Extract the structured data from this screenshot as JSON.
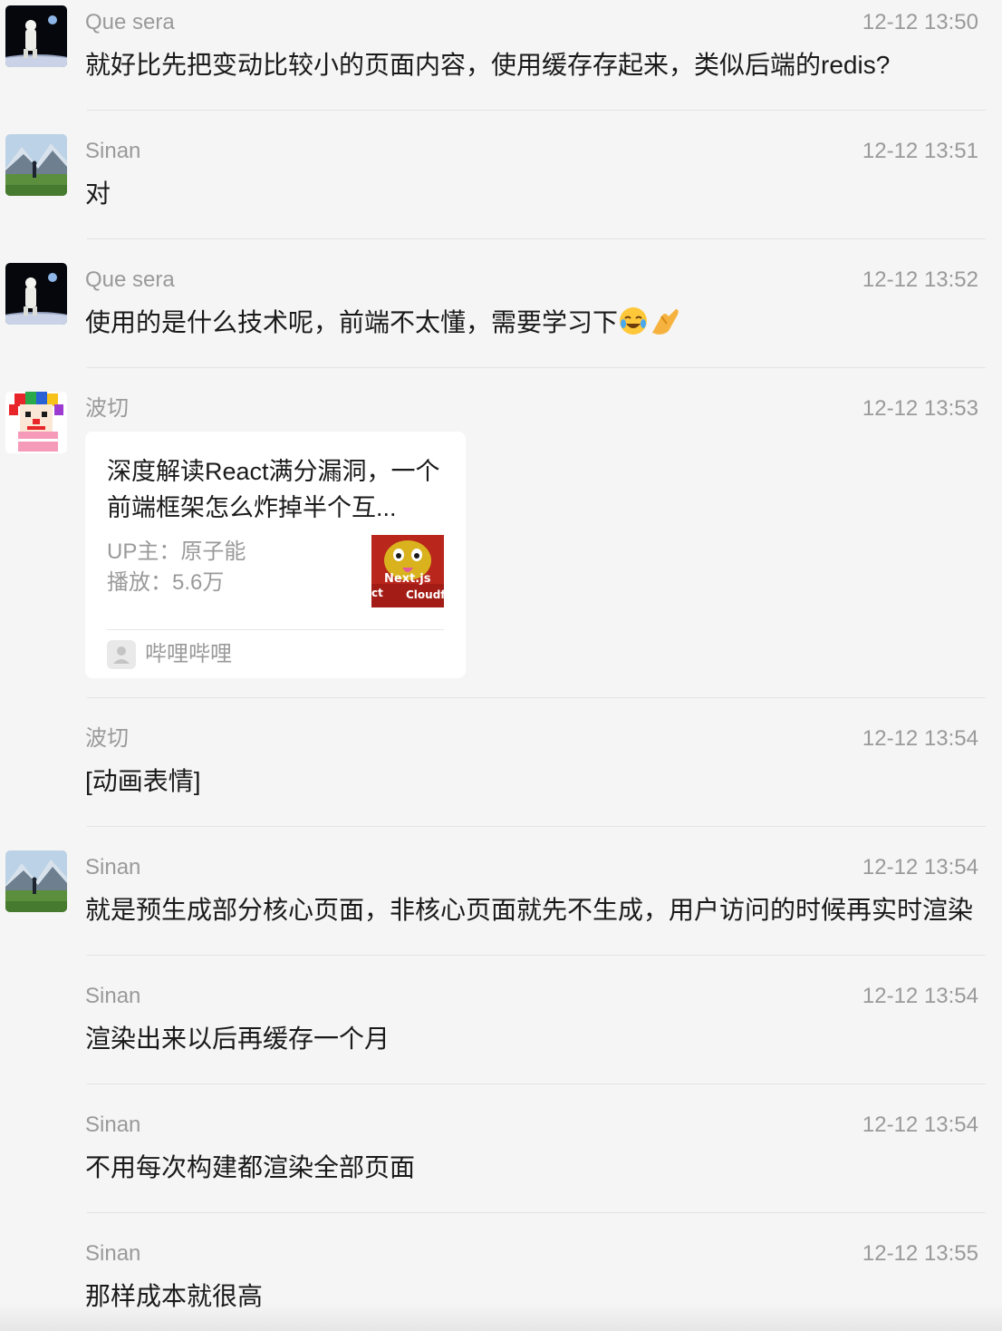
{
  "messages": [
    {
      "sender": "Que sera",
      "time": "12-12 13:50",
      "text": "就好比先把变动比较小的页面内容，使用缓存存起来，类似后端的redis?"
    },
    {
      "sender": "Sinan",
      "time": "12-12 13:51",
      "text": "对"
    },
    {
      "sender": "Que sera",
      "time": "12-12 13:52",
      "text": "使用的是什么技术呢，前端不太懂，需要学习下",
      "emojis": [
        "laughing-crying-emoji",
        "pinched-hand-emoji"
      ]
    },
    {
      "sender": "波切",
      "time": "12-12 13:53",
      "card": {
        "title": "深度解读React满分漏洞，一个前端框架怎么炸掉半个互...",
        "uploader": "UP主：原子能",
        "plays": "播放：5.6万",
        "thumbnail_text": "Next.js",
        "thumbnail_text_2": "ct",
        "thumbnail_text_3": "Cloudf",
        "source": "哔哩哔哩"
      }
    },
    {
      "sender": "波切",
      "time": "12-12 13:54",
      "text": "[动画表情]"
    },
    {
      "sender": "Sinan",
      "time": "12-12 13:54",
      "text": "就是预生成部分核心页面，非核心页面就先不生成，用户访问的时候再实时渲染"
    },
    {
      "sender": "Sinan",
      "time": "12-12 13:54",
      "text": "渲染出来以后再缓存一个月"
    },
    {
      "sender": "Sinan",
      "time": "12-12 13:54",
      "text": "不用每次构建都渲染全部页面"
    },
    {
      "sender": "Sinan",
      "time": "12-12 13:55",
      "text": "那样成本就很高"
    }
  ],
  "colors": {
    "background": "#f5f5f5",
    "meta_text": "#9a9a9a",
    "body_text": "#1a1a1a",
    "card_bg": "#ffffff"
  }
}
